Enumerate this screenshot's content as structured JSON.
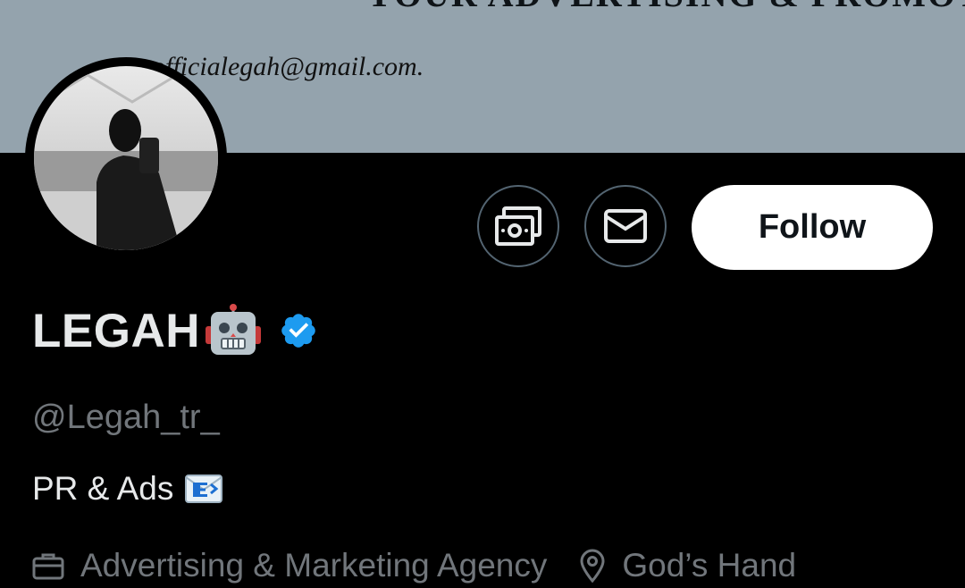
{
  "banner": {
    "headline": "YOUR ADVERTISING & PROMOTION",
    "email": "officialegah@gmail.com."
  },
  "profile": {
    "display_name": "LEGAH",
    "name_emoji": "robot-face-emoji",
    "verified_badge": "verified-icon",
    "handle": "@Legah_tr_",
    "bio": "PR & Ads",
    "bio_emoji": "incoming-envelope-emoji",
    "category": "Advertising & Marketing Agency",
    "location": "God’s Hand"
  },
  "actions": {
    "tip_icon": "money-icon",
    "message_icon": "envelope-icon",
    "follow_label": "Follow"
  },
  "colors": {
    "background": "#000000",
    "banner": "#94a3ad",
    "text_primary": "#e7e9ea",
    "text_secondary": "#71767b",
    "verified_blue": "#1d9bf0",
    "button_border": "#536471"
  }
}
